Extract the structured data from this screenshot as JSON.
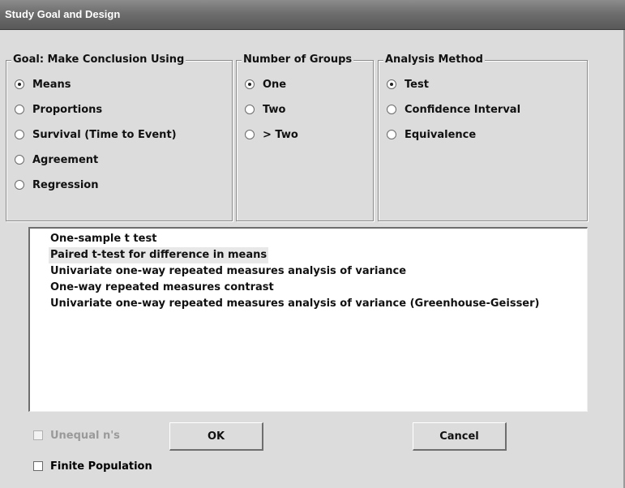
{
  "window": {
    "title": "Study Goal and Design"
  },
  "goal": {
    "title": "Goal: Make Conclusion Using",
    "options": [
      {
        "label": "Means",
        "selected": true
      },
      {
        "label": "Proportions",
        "selected": false
      },
      {
        "label": "Survival (Time to Event)",
        "selected": false
      },
      {
        "label": "Agreement",
        "selected": false
      },
      {
        "label": "Regression",
        "selected": false
      }
    ]
  },
  "groups": {
    "title": "Number of Groups",
    "options": [
      {
        "label": "One",
        "selected": true
      },
      {
        "label": "Two",
        "selected": false
      },
      {
        "label": "> Two",
        "selected": false
      }
    ]
  },
  "analysis": {
    "title": "Analysis Method",
    "options": [
      {
        "label": "Test",
        "selected": true
      },
      {
        "label": "Confidence Interval",
        "selected": false
      },
      {
        "label": "Equivalence",
        "selected": false
      }
    ]
  },
  "tests": {
    "items": [
      "One-sample t test",
      "Paired t-test for difference in means",
      "Univariate one-way repeated measures analysis of variance",
      "One-way repeated measures contrast",
      "Univariate one-way repeated measures analysis of variance (Greenhouse-Geisser)"
    ],
    "selected_index": 1
  },
  "options": {
    "unequal_n": {
      "label": "Unequal n's",
      "checked": false,
      "enabled": false
    },
    "finite_population": {
      "label": "Finite Population",
      "checked": false,
      "enabled": true
    }
  },
  "buttons": {
    "ok": "OK",
    "cancel": "Cancel"
  }
}
